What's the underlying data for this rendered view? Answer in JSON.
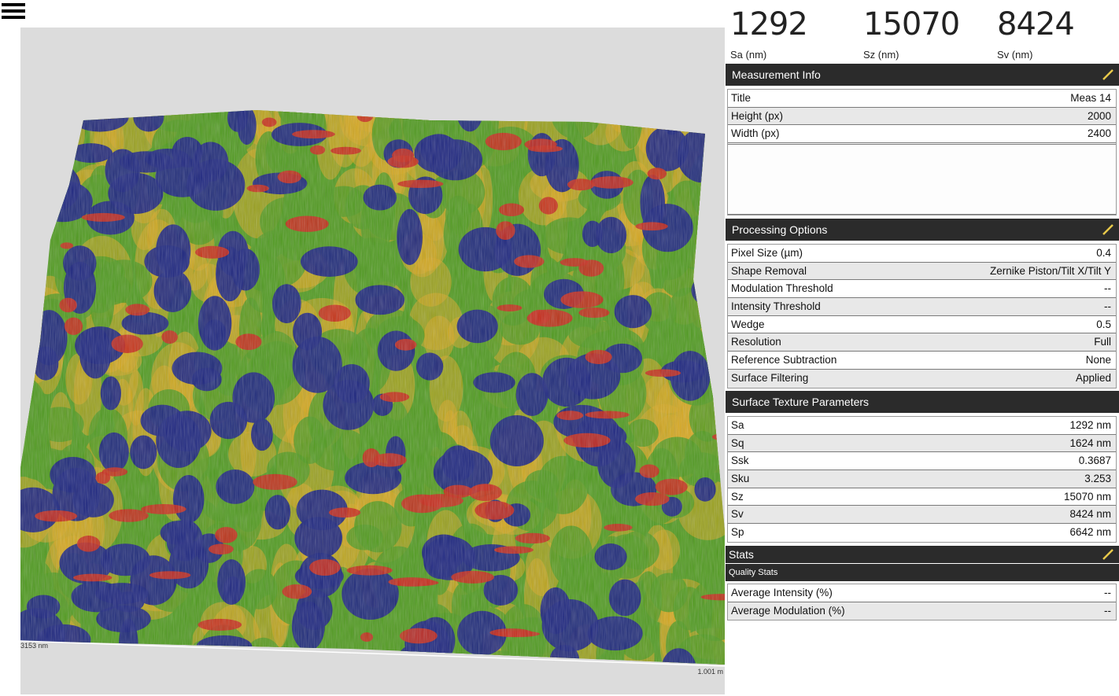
{
  "header_stats": [
    {
      "value": "1292",
      "label": "Sa (nm)"
    },
    {
      "value": "15070",
      "label": "Sz (nm)"
    },
    {
      "value": "8424",
      "label": "Sv (nm)"
    }
  ],
  "viewport": {
    "scale_left": "3153 nm",
    "scale_right": "1.001 m"
  },
  "measurement_info": {
    "title": "Measurement Info",
    "rows": [
      {
        "label": "Title",
        "value": "Meas 14"
      },
      {
        "label": "Height (px)",
        "value": "2000"
      },
      {
        "label": "Width (px)",
        "value": "2400"
      }
    ]
  },
  "processing_options": {
    "title": "Processing Options",
    "rows": [
      {
        "label": "Pixel Size (µm)",
        "value": "0.4"
      },
      {
        "label": "Shape Removal",
        "value": "Zernike Piston/Tilt X/Tilt Y"
      },
      {
        "label": "Modulation Threshold",
        "value": "--"
      },
      {
        "label": "Intensity Threshold",
        "value": "--"
      },
      {
        "label": "Wedge",
        "value": "0.5"
      },
      {
        "label": "Resolution",
        "value": "Full"
      },
      {
        "label": "Reference Subtraction",
        "value": "None"
      },
      {
        "label": "Surface Filtering",
        "value": "Applied"
      }
    ]
  },
  "surface_texture": {
    "title": "Surface Texture Parameters",
    "rows": [
      {
        "label": "Sa",
        "value": "1292 nm"
      },
      {
        "label": "Sq",
        "value": "1624 nm"
      },
      {
        "label": "Ssk",
        "value": "0.3687"
      },
      {
        "label": "Sku",
        "value": "3.253"
      },
      {
        "label": "Sz",
        "value": "15070 nm"
      },
      {
        "label": "Sv",
        "value": "8424 nm"
      },
      {
        "label": "Sp",
        "value": "6642 nm"
      }
    ]
  },
  "stats": {
    "title": "Stats",
    "subtitle": "Quality Stats",
    "rows": [
      {
        "label": "Average Intensity (%)",
        "value": "--"
      },
      {
        "label": "Average Modulation (%)",
        "value": "--"
      }
    ]
  },
  "colors": {
    "header_bg": "#2b2b2b",
    "viewport_bg": "#dcdcdc",
    "edit_icon": "#e8c94a",
    "surface_low": "#1a237e",
    "surface_mid": "#4e9a1c",
    "surface_high": "#d8a81e",
    "surface_peak": "#c8281a"
  }
}
